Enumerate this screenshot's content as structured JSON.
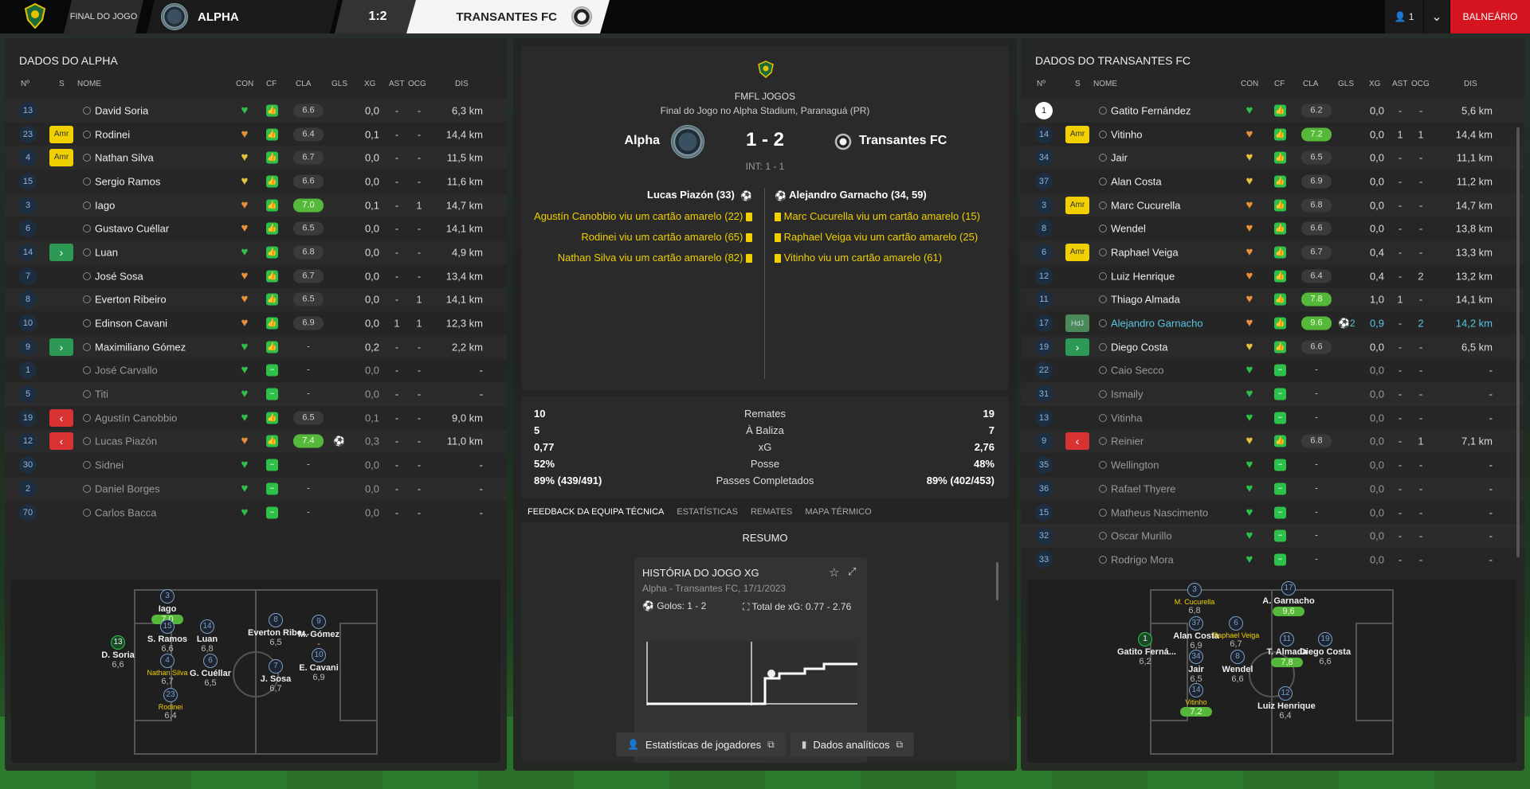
{
  "topbar": {
    "status": "FINAL DO JOGO",
    "home_team": "ALPHA",
    "score": "1:2",
    "away_team": "TRANSANTES FC",
    "user_count": "1",
    "balneario": "BALNEÁRIO"
  },
  "left": {
    "title": "DADOS DO ALPHA",
    "headers": {
      "no": "Nº",
      "s": "S",
      "nome": "NOME",
      "con": "CON",
      "cf": "CF",
      "cla": "CLA",
      "gls": "GLS",
      "xg": "XG",
      "ast": "AST",
      "ocg": "OCG",
      "dis": "DIS"
    },
    "players": [
      {
        "no": "13",
        "s": "",
        "name": "David Soria",
        "cla": "6.6",
        "good": false,
        "gls": "",
        "xg": "0,0",
        "ast": "-",
        "ocg": "-",
        "dis": "6,3 km",
        "dim": false,
        "con": "green"
      },
      {
        "no": "23",
        "s": "Amr",
        "name": "Rodinei",
        "cla": "6.4",
        "good": false,
        "gls": "",
        "xg": "0,1",
        "ast": "-",
        "ocg": "-",
        "dis": "14,4 km",
        "dim": false,
        "con": "orange"
      },
      {
        "no": "4",
        "s": "Amr",
        "name": "Nathan Silva",
        "cla": "6.7",
        "good": false,
        "gls": "",
        "xg": "0,0",
        "ast": "-",
        "ocg": "-",
        "dis": "11,5 km",
        "dim": false,
        "con": "yellow"
      },
      {
        "no": "15",
        "s": "",
        "name": "Sergio Ramos",
        "cla": "6.6",
        "good": false,
        "gls": "",
        "xg": "0,0",
        "ast": "-",
        "ocg": "-",
        "dis": "11,6 km",
        "dim": false,
        "con": "yellow"
      },
      {
        "no": "3",
        "s": "",
        "name": "Iago",
        "cla": "7.0",
        "good": true,
        "gls": "",
        "xg": "0,1",
        "ast": "-",
        "ocg": "1",
        "dis": "14,7 km",
        "dim": false,
        "con": "orange"
      },
      {
        "no": "6",
        "s": "",
        "name": "Gustavo Cuéllar",
        "cla": "6.5",
        "good": false,
        "gls": "",
        "xg": "0,0",
        "ast": "-",
        "ocg": "-",
        "dis": "14,1 km",
        "dim": false,
        "con": "orange"
      },
      {
        "no": "14",
        "s": "in",
        "name": "Luan",
        "cla": "6.8",
        "good": false,
        "gls": "",
        "xg": "0,0",
        "ast": "-",
        "ocg": "-",
        "dis": "4,9 km",
        "dim": false,
        "con": "green"
      },
      {
        "no": "7",
        "s": "",
        "name": "José Sosa",
        "cla": "6.7",
        "good": false,
        "gls": "",
        "xg": "0,0",
        "ast": "-",
        "ocg": "-",
        "dis": "13,4 km",
        "dim": false,
        "con": "orange"
      },
      {
        "no": "8",
        "s": "",
        "name": "Everton Ribeiro",
        "cla": "6.5",
        "good": false,
        "gls": "",
        "xg": "0,0",
        "ast": "-",
        "ocg": "1",
        "dis": "14,1 km",
        "dim": false,
        "con": "orange"
      },
      {
        "no": "10",
        "s": "",
        "name": "Edinson Cavani",
        "cla": "6.9",
        "good": false,
        "gls": "",
        "xg": "0,0",
        "ast": "1",
        "ocg": "1",
        "dis": "12,3 km",
        "dim": false,
        "con": "orange"
      },
      {
        "no": "9",
        "s": "in",
        "name": "Maximiliano Gómez",
        "cla": "-",
        "good": false,
        "gls": "",
        "xg": "0,2",
        "ast": "-",
        "ocg": "-",
        "dis": "2,2 km",
        "dim": false,
        "con": "green"
      },
      {
        "no": "1",
        "s": "",
        "name": "José Carvallo",
        "cla": "-",
        "good": false,
        "gls": "",
        "xg": "0,0",
        "ast": "-",
        "ocg": "-",
        "dis": "-",
        "dim": true,
        "con": "green"
      },
      {
        "no": "5",
        "s": "",
        "name": "Titi",
        "cla": "-",
        "good": false,
        "gls": "",
        "xg": "0,0",
        "ast": "-",
        "ocg": "-",
        "dis": "-",
        "dim": true,
        "con": "green"
      },
      {
        "no": "19",
        "s": "out",
        "name": "Agustín Canobbio",
        "cla": "6.5",
        "good": false,
        "gls": "",
        "xg": "0,1",
        "ast": "-",
        "ocg": "-",
        "dis": "9,0 km",
        "dim": true,
        "con": "green"
      },
      {
        "no": "12",
        "s": "out",
        "name": "Lucas Piazón",
        "cla": "7.4",
        "good": true,
        "gls": "⚽",
        "xg": "0,3",
        "ast": "-",
        "ocg": "-",
        "dis": "11,0 km",
        "dim": true,
        "con": "orange"
      },
      {
        "no": "30",
        "s": "",
        "name": "Sidnei",
        "cla": "-",
        "good": false,
        "gls": "",
        "xg": "0,0",
        "ast": "-",
        "ocg": "-",
        "dis": "-",
        "dim": true,
        "con": "green"
      },
      {
        "no": "2",
        "s": "",
        "name": "Daniel Borges",
        "cla": "-",
        "good": false,
        "gls": "",
        "xg": "0,0",
        "ast": "-",
        "ocg": "-",
        "dis": "-",
        "dim": true,
        "con": "green"
      },
      {
        "no": "70",
        "s": "",
        "name": "Carlos Bacca",
        "cla": "-",
        "good": false,
        "gls": "",
        "xg": "0,0",
        "ast": "-",
        "ocg": "-",
        "dis": "-",
        "dim": true,
        "con": "green"
      }
    ],
    "pitch": [
      {
        "no": "3",
        "name": "Iago",
        "rating": "7,0",
        "good": true,
        "yellow": false
      },
      {
        "no": "13",
        "name": "D. Soria",
        "rating": "6,6",
        "good": false,
        "yellow": false,
        "gk": true
      },
      {
        "no": "15",
        "name": "S. Ramos",
        "rating": "6,6",
        "good": false,
        "yellow": false
      },
      {
        "no": "14",
        "name": "Luan",
        "rating": "6,8",
        "good": false,
        "yellow": false
      },
      {
        "no": "4",
        "name": "Nathan Silva",
        "rating": "6,7",
        "good": false,
        "yellow": true
      },
      {
        "no": "6",
        "name": "G. Cuéllar",
        "rating": "6,5",
        "good": false,
        "yellow": false
      },
      {
        "no": "23",
        "name": "Rodinei",
        "rating": "6,4",
        "good": false,
        "yellow": true
      },
      {
        "no": "8",
        "name": "Everton Ribe...",
        "rating": "6,5",
        "good": false,
        "yellow": false
      },
      {
        "no": "7",
        "name": "J. Sosa",
        "rating": "6,7",
        "good": false,
        "yellow": false
      },
      {
        "no": "9",
        "name": "M. Gómez",
        "rating": "-",
        "good": false,
        "yellow": false
      },
      {
        "no": "10",
        "name": "E. Cavani",
        "rating": "6,9",
        "good": false,
        "yellow": false
      }
    ]
  },
  "center": {
    "competition": "FMFL JOGOS",
    "venue": "Final do Jogo no Alpha Stadium, Paranaguá (PR)",
    "home": "Alpha",
    "score": "1 - 2",
    "away": "Transantes FC",
    "halftime": "INT: 1 - 1",
    "home_goal": "Lucas Piazón (33)",
    "away_goal": "Alejandro Garnacho (34, 59)",
    "home_events": [
      "Agustín Canobbio viu um cartão amarelo (22)",
      "Rodinei viu um cartão amarelo (65)",
      "Nathan Silva viu um cartão amarelo (82)"
    ],
    "away_events": [
      "Marc Cucurella viu um cartão amarelo (15)",
      "Raphael Veiga viu um cartão amarelo (25)",
      "Vitinho viu um cartão amarelo (61)"
    ],
    "stats": [
      {
        "l": "10",
        "m": "Remates",
        "r": "19"
      },
      {
        "l": "5",
        "m": "À Baliza",
        "r": "7"
      },
      {
        "l": "0,77",
        "m": "xG",
        "r": "2,76"
      },
      {
        "l": "52%",
        "m": "Posse",
        "r": "48%"
      },
      {
        "l": "89% (439/491)",
        "m": "Passes Completados",
        "r": "89% (402/453)"
      }
    ],
    "tabs": [
      "FEEDBACK DA EQUIPA TÉCNICA",
      "ESTATÍSTICAS",
      "REMATES",
      "MAPA TÉRMICO"
    ],
    "resumo": "RESUMO",
    "xg_title": "HISTÓRIA DO JOGO XG",
    "xg_sub": "Alpha - Transantes FC, 17/1/2023",
    "xg_goals": "Golos: 1 - 2",
    "xg_total": "Total de xG: 0.77 - 2.76",
    "btn_players": "Estatísticas de jogadores",
    "btn_analytics": "Dados analíticos"
  },
  "right": {
    "title": "DADOS DO TRANSANTES FC",
    "players": [
      {
        "no": "1",
        "s": "",
        "name": "Gatito Fernández",
        "cla": "6.2",
        "good": false,
        "gls": "",
        "xg": "0,0",
        "ast": "-",
        "ocg": "-",
        "dis": "5,6 km",
        "dim": false,
        "hl": false,
        "con": "green",
        "first": true
      },
      {
        "no": "14",
        "s": "Amr",
        "name": "Vitinho",
        "cla": "7.2",
        "good": true,
        "gls": "",
        "xg": "0,0",
        "ast": "1",
        "ocg": "1",
        "dis": "14,4 km",
        "dim": false,
        "hl": false,
        "con": "orange"
      },
      {
        "no": "34",
        "s": "",
        "name": "Jair",
        "cla": "6.5",
        "good": false,
        "gls": "",
        "xg": "0,0",
        "ast": "-",
        "ocg": "-",
        "dis": "11,1 km",
        "dim": false,
        "hl": false,
        "con": "yellow"
      },
      {
        "no": "37",
        "s": "",
        "name": "Alan Costa",
        "cla": "6.9",
        "good": false,
        "gls": "",
        "xg": "0,0",
        "ast": "-",
        "ocg": "-",
        "dis": "11,2 km",
        "dim": false,
        "hl": false,
        "con": "yellow"
      },
      {
        "no": "3",
        "s": "Amr",
        "name": "Marc Cucurella",
        "cla": "6.8",
        "good": false,
        "gls": "",
        "xg": "0,0",
        "ast": "-",
        "ocg": "-",
        "dis": "14,7 km",
        "dim": false,
        "hl": false,
        "con": "orange"
      },
      {
        "no": "8",
        "s": "",
        "name": "Wendel",
        "cla": "6.6",
        "good": false,
        "gls": "",
        "xg": "0,0",
        "ast": "-",
        "ocg": "-",
        "dis": "13,8 km",
        "dim": false,
        "hl": false,
        "con": "orange"
      },
      {
        "no": "6",
        "s": "Amr",
        "name": "Raphael Veiga",
        "cla": "6.7",
        "good": false,
        "gls": "",
        "xg": "0,4",
        "ast": "-",
        "ocg": "-",
        "dis": "13,3 km",
        "dim": false,
        "hl": false,
        "con": "orange"
      },
      {
        "no": "12",
        "s": "",
        "name": "Luiz Henrique",
        "cla": "6.4",
        "good": false,
        "gls": "",
        "xg": "0,4",
        "ast": "-",
        "ocg": "2",
        "dis": "13,2 km",
        "dim": false,
        "hl": false,
        "con": "orange"
      },
      {
        "no": "11",
        "s": "",
        "name": "Thiago Almada",
        "cla": "7.8",
        "good": true,
        "gls": "",
        "xg": "1,0",
        "ast": "1",
        "ocg": "-",
        "dis": "14,1 km",
        "dim": false,
        "hl": false,
        "con": "orange"
      },
      {
        "no": "17",
        "s": "HdJ",
        "name": "Alejandro Garnacho",
        "cla": "9.6",
        "good": true,
        "gls": "⚽2",
        "xg": "0,9",
        "ast": "-",
        "ocg": "2",
        "dis": "14,2 km",
        "dim": false,
        "hl": true,
        "con": "orange"
      },
      {
        "no": "19",
        "s": "in",
        "name": "Diego Costa",
        "cla": "6.6",
        "good": false,
        "gls": "",
        "xg": "0,0",
        "ast": "-",
        "ocg": "-",
        "dis": "6,5 km",
        "dim": false,
        "hl": false,
        "con": "yellow"
      },
      {
        "no": "22",
        "s": "",
        "name": "Caio Secco",
        "cla": "-",
        "good": false,
        "gls": "",
        "xg": "0,0",
        "ast": "-",
        "ocg": "-",
        "dis": "-",
        "dim": true,
        "hl": false,
        "con": "green"
      },
      {
        "no": "31",
        "s": "",
        "name": "Ismaily",
        "cla": "-",
        "good": false,
        "gls": "",
        "xg": "0,0",
        "ast": "-",
        "ocg": "-",
        "dis": "-",
        "dim": true,
        "hl": false,
        "con": "green"
      },
      {
        "no": "13",
        "s": "",
        "name": "Vitinha",
        "cla": "-",
        "good": false,
        "gls": "",
        "xg": "0,0",
        "ast": "-",
        "ocg": "-",
        "dis": "-",
        "dim": true,
        "hl": false,
        "con": "green"
      },
      {
        "no": "9",
        "s": "out",
        "name": "Reinier",
        "cla": "6.8",
        "good": false,
        "gls": "",
        "xg": "0,0",
        "ast": "-",
        "ocg": "1",
        "dis": "7,1 km",
        "dim": true,
        "hl": false,
        "con": "yellow"
      },
      {
        "no": "35",
        "s": "",
        "name": "Wellington",
        "cla": "-",
        "good": false,
        "gls": "",
        "xg": "0,0",
        "ast": "-",
        "ocg": "-",
        "dis": "-",
        "dim": true,
        "hl": false,
        "con": "green"
      },
      {
        "no": "36",
        "s": "",
        "name": "Rafael Thyere",
        "cla": "-",
        "good": false,
        "gls": "",
        "xg": "0,0",
        "ast": "-",
        "ocg": "-",
        "dis": "-",
        "dim": true,
        "hl": false,
        "con": "green"
      },
      {
        "no": "15",
        "s": "",
        "name": "Matheus Nascimento",
        "cla": "-",
        "good": false,
        "gls": "",
        "xg": "0,0",
        "ast": "-",
        "ocg": "-",
        "dis": "-",
        "dim": true,
        "hl": false,
        "con": "green"
      },
      {
        "no": "32",
        "s": "",
        "name": "Oscar Murillo",
        "cla": "-",
        "good": false,
        "gls": "",
        "xg": "0,0",
        "ast": "-",
        "ocg": "-",
        "dis": "-",
        "dim": true,
        "hl": false,
        "con": "green"
      },
      {
        "no": "33",
        "s": "",
        "name": "Rodrigo Mora",
        "cla": "-",
        "good": false,
        "gls": "",
        "xg": "0,0",
        "ast": "-",
        "ocg": "-",
        "dis": "-",
        "dim": true,
        "hl": false,
        "con": "green"
      }
    ],
    "pitch": [
      {
        "no": "3",
        "name": "M. Cucurella",
        "rating": "6,8",
        "good": false,
        "yellow": true
      },
      {
        "no": "17",
        "name": "A. Garnacho",
        "rating": "9,6",
        "good": true,
        "yellow": false
      },
      {
        "no": "1",
        "name": "Gatito Ferná...",
        "rating": "6,2",
        "good": false,
        "yellow": false,
        "gk": true
      },
      {
        "no": "37",
        "name": "Alan Costa",
        "rating": "6,9",
        "good": false,
        "yellow": false
      },
      {
        "no": "6",
        "name": "Raphael Veiga",
        "rating": "6,7",
        "good": false,
        "yellow": true
      },
      {
        "no": "11",
        "name": "T. Almada",
        "rating": "7,8",
        "good": true,
        "yellow": false
      },
      {
        "no": "19",
        "name": "Diego Costa",
        "rating": "6,6",
        "good": false,
        "yellow": false
      },
      {
        "no": "34",
        "name": "Jair",
        "rating": "6,5",
        "good": false,
        "yellow": false
      },
      {
        "no": "8",
        "name": "Wendel",
        "rating": "6,6",
        "good": false,
        "yellow": false
      },
      {
        "no": "14",
        "name": "Vitinho",
        "rating": "7,2",
        "good": true,
        "yellow": true
      },
      {
        "no": "12",
        "name": "Luiz Henrique",
        "rating": "6,4",
        "good": false,
        "yellow": false
      }
    ]
  },
  "colors": {
    "accent": "#2ec14a",
    "yellow": "#f0d000",
    "red": "#d4141e",
    "highlight": "#58c6e0"
  }
}
